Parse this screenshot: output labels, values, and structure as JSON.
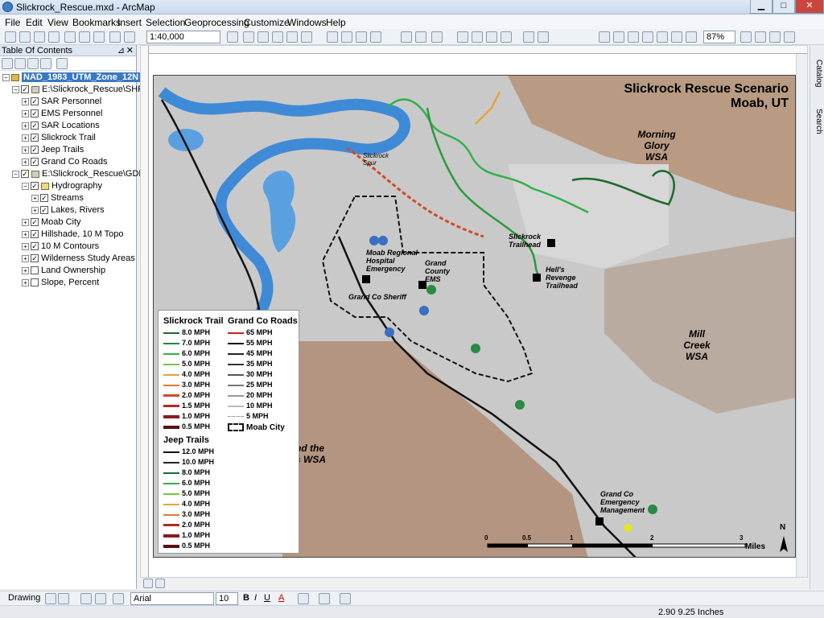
{
  "window": {
    "title": "Slickrock_Rescue.mxd - ArcMap"
  },
  "menu": [
    "File",
    "Edit",
    "View",
    "Bookmarks",
    "Insert",
    "Selection",
    "Geoprocessing",
    "Customize",
    "Windows",
    "Help"
  ],
  "toolbar": {
    "scale": "1:40,000",
    "zoom": "87%"
  },
  "toc": {
    "title": "Table Of Contents",
    "frame": "NAD_1983_UTM_Zone_12N",
    "group1": "E:\\Slickrock_Rescue\\SHPFiles\\",
    "group1_items": [
      "SAR Personnel",
      "EMS Personnel",
      "SAR Locations",
      "Slickrock Trail",
      "Jeep Trails",
      "Grand Co Roads"
    ],
    "group2": "E:\\Slickrock_Rescue\\GDBFiles\\",
    "hydrography": "Hydrography",
    "hydro_items": [
      "Streams",
      "Lakes, Rivers"
    ],
    "group2_items": [
      "Moab City",
      "Hillshade, 10 M Topo",
      "10 M Contours",
      "Wilderness Study Areas",
      "Land Ownership",
      "Slope, Percent"
    ]
  },
  "dock": {
    "catalog": "Catalog",
    "search": "Search"
  },
  "map": {
    "title_line1": "Slickrock Rescue Scenario",
    "title_line2": "Moab, UT",
    "labels": {
      "morning_glory": "Morning\nGlory WSA",
      "mill_creek": "Mill\nCreek\nWSA",
      "negro_bill": "nd the\ns WSA",
      "slickrock_trailhead": "Slickrock\nTrailhead",
      "hells_revenge": "Hell's\nRevenge\nTrailhead",
      "hospital": "Moab Regional\nHospital\nEmergency",
      "county_ems": "Grand\nCounty\nEMS",
      "sheriff": "Grand Co Sheriff",
      "emergency_mgmt": "Grand Co\nEmergency\nManagement",
      "slickrock_spur": "Slickrock\nSpur"
    },
    "scalebar": {
      "ticks": [
        "0",
        "0.5",
        "1",
        "2",
        "3"
      ],
      "unit": "Miles"
    },
    "north": "N"
  },
  "legend": {
    "slickrock_title": "Slickrock Trail",
    "slickrock_items": [
      "8.0 MPH",
      "7.0 MPH",
      "6.0 MPH",
      "5.0 MPH",
      "4.0 MPH",
      "3.0 MPH",
      "2.0 MPH",
      "1.5 MPH",
      "1.0 MPH",
      "0.5 MPH"
    ],
    "slickrock_colors": [
      "#1b6a2c",
      "#1f8a36",
      "#33b04a",
      "#7cc04a",
      "#e2a43b",
      "#e27a2a",
      "#d24a26",
      "#b22a22",
      "#8a1c1c",
      "#5a1010"
    ],
    "roads_title": "Grand Co Roads",
    "roads_items": [
      "65 MPH",
      "55 MPH",
      "45 MPH",
      "35 MPH",
      "30 MPH",
      "25 MPH",
      "20 MPH",
      "10 MPH",
      "5 MPH"
    ],
    "roads_colors": [
      "#d01e1e",
      "#111111",
      "#222222",
      "#333333",
      "#555555",
      "#777777",
      "#999999",
      "#bbbbbb",
      "#cccccc"
    ],
    "city_label": "Moab City",
    "jeep_title": "Jeep Trails",
    "jeep_items": [
      "12.0 MPH",
      "10.0 MPH",
      "8.0 MPH",
      "6.0 MPH",
      "5.0 MPH",
      "4.0 MPH",
      "3.0 MPH",
      "2.0 MPH",
      "1.0 MPH",
      "0.5 MPH"
    ],
    "jeep_colors": [
      "#111111",
      "#222222",
      "#1b6a2c",
      "#33b04a",
      "#7cc04a",
      "#e2a43b",
      "#e27a2a",
      "#b22a22",
      "#8a1c1c",
      "#5a1010"
    ]
  },
  "drawbar": {
    "drawing": "Drawing",
    "font": "Arial",
    "size": "10"
  },
  "status": {
    "coords": "2.90  9.25 Inches"
  }
}
